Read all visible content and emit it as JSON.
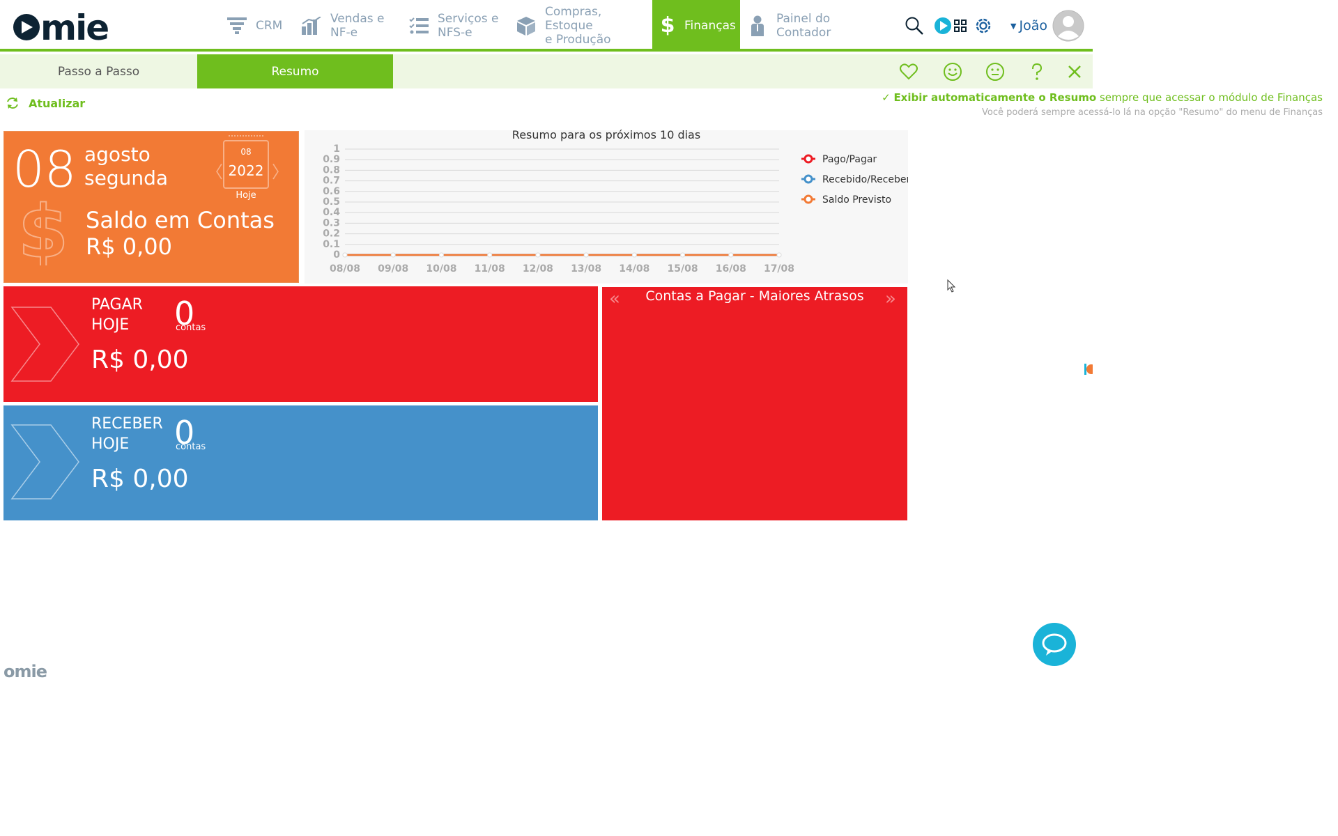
{
  "header": {
    "logo_text": "omie",
    "nav": [
      {
        "label1": "CRM",
        "label2": "",
        "icon": "filter-icon"
      },
      {
        "label1": "Vendas e",
        "label2": "NF-e",
        "icon": "bar-chart-icon"
      },
      {
        "label1": "Serviços e",
        "label2": "NFS-e",
        "icon": "list-icon"
      },
      {
        "label1": "Compras, Estoque",
        "label2": "e Produção",
        "icon": "box-icon"
      },
      {
        "label1": "Finanças",
        "label2": "",
        "icon": "dollar-icon"
      },
      {
        "label1": "Painel do",
        "label2": "Contador",
        "icon": "person-icon"
      }
    ],
    "user_name": "João",
    "colors": {
      "accent": "#6fbe1e",
      "nav_text": "#8aa0b4"
    }
  },
  "tabs": [
    {
      "label": "Passo a Passo"
    },
    {
      "label": "Resumo"
    }
  ],
  "toolbar_icons": [
    "heart-icon",
    "smile-icon",
    "neutral-face-icon",
    "help-icon",
    "close-icon"
  ],
  "refresh_label": "Atualizar",
  "auto_show": {
    "bold": "Exibir automaticamente o Resumo",
    "rest": " sempre que acessar o módulo de Finanças",
    "sub": "Você poderá sempre acessá-lo lá na opção \"Resumo\" do menu de Finanças"
  },
  "date_card": {
    "day": "08",
    "month": "agosto",
    "weekday": "segunda",
    "cal_day": "08",
    "year": "2022",
    "today_label": "Hoje",
    "saldo_label": "Saldo em Contas",
    "saldo_value": "R$ 0,00",
    "color": "#f27a35"
  },
  "chart_data": {
    "type": "line",
    "title": "Resumo para os próximos 10 dias",
    "categories": [
      "08/08",
      "09/08",
      "10/08",
      "11/08",
      "12/08",
      "13/08",
      "14/08",
      "15/08",
      "16/08",
      "17/08"
    ],
    "y_ticks": [
      "0",
      "0.1",
      "0.2",
      "0.3",
      "0.4",
      "0.5",
      "0.6",
      "0.7",
      "0.8",
      "0.9",
      "1"
    ],
    "ylim": [
      0,
      1
    ],
    "grid": true,
    "legend_position": "right",
    "series": [
      {
        "name": "Pago/Pagar",
        "color": "#ed1c24",
        "values": [
          0,
          0,
          0,
          0,
          0,
          0,
          0,
          0,
          0,
          0
        ]
      },
      {
        "name": "Recebido/Receber",
        "color": "#4591ca",
        "values": [
          0,
          0,
          0,
          0,
          0,
          0,
          0,
          0,
          0,
          0
        ]
      },
      {
        "name": "Saldo Previsto",
        "color": "#f27a35",
        "values": [
          0,
          0,
          0,
          0,
          0,
          0,
          0,
          0,
          0,
          0
        ]
      }
    ]
  },
  "pagar": {
    "line1": "PAGAR",
    "line2": "HOJE",
    "count": "0",
    "count_label": "contas",
    "amount": "R$ 0,00",
    "color": "#ed1c24"
  },
  "receber": {
    "line1": "RECEBER",
    "line2": "HOJE",
    "count": "0",
    "count_label": "contas",
    "amount": "R$ 0,00",
    "color": "#4591ca"
  },
  "atrasos": {
    "title": "Contas a Pagar - Maiores Atrasos"
  },
  "footer_logo": "omie"
}
